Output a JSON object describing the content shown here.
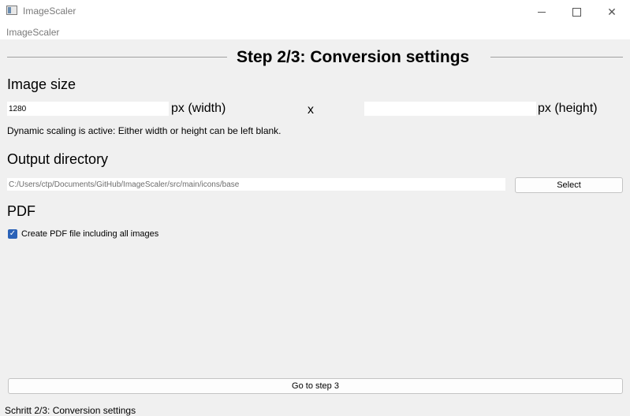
{
  "window": {
    "title": "ImageScaler",
    "minimize_glyph": "",
    "maximize_glyph": "",
    "close_glyph": "✕"
  },
  "menubar": {
    "app_label": "ImageScaler"
  },
  "step": {
    "title": "Step 2/3: Conversion settings"
  },
  "image_size": {
    "heading": "Image size",
    "width_value": "1280",
    "width_unit": "px (width)",
    "separator": "x",
    "height_value": "",
    "height_unit": "px (height)",
    "hint": "Dynamic scaling is active:  Either width or height can be left blank."
  },
  "output_directory": {
    "heading": "Output directory",
    "path": "C:/Users/ctp/Documents/GitHub/ImageScaler/src/main/icons/base",
    "select_label": "Select"
  },
  "pdf": {
    "heading": "PDF",
    "checkbox_label": "Create PDF file including all images",
    "checked": true,
    "check_glyph": "✓"
  },
  "footer": {
    "next_label": "Go to step 3"
  },
  "status": {
    "text": "Schritt 2/3: Conversion settings"
  },
  "colors": {
    "accent": "#2a62b8",
    "background": "#f0f0f0"
  },
  "icons": [
    "app-icon",
    "minimize-icon",
    "maximize-icon",
    "close-icon",
    "checkmark-icon"
  ]
}
